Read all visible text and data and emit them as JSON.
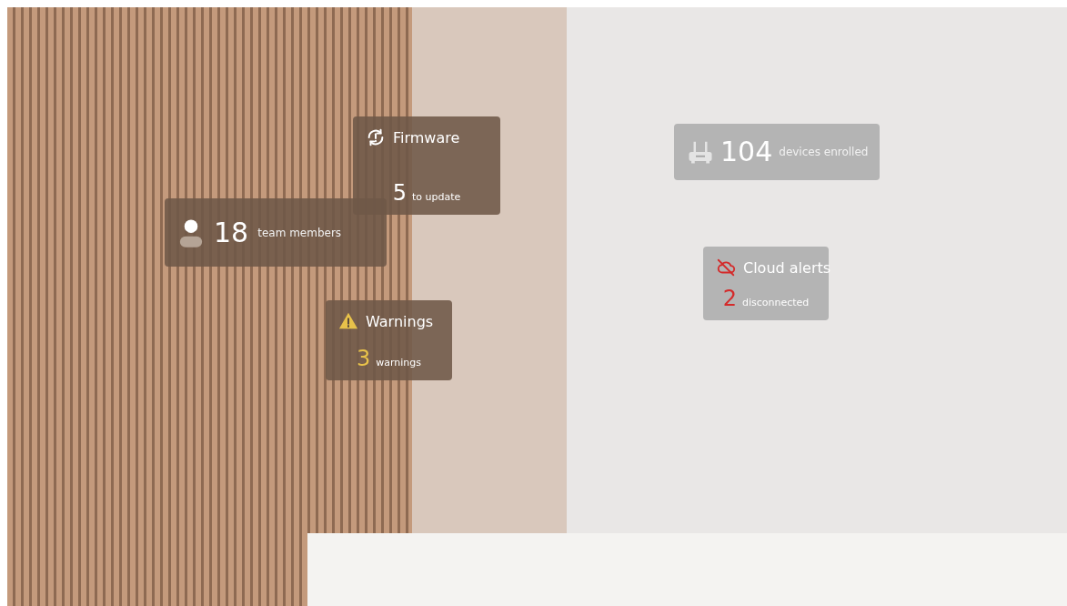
{
  "cards": [
    {
      "kind": "titled",
      "title": "Firmware",
      "count": "5",
      "label": "to update",
      "color": "#ffffff"
    },
    {
      "kind": "stat",
      "count": "18",
      "label": "team members",
      "color": "#ffffff"
    },
    {
      "kind": "titled",
      "title": "Warnings",
      "count": "3",
      "label": "warnings",
      "color": "#e8c24a"
    },
    {
      "kind": "stat",
      "count": "104",
      "label": "devices enrolled",
      "color": "#ffffff"
    },
    {
      "kind": "titled",
      "title": "Cloud alerts",
      "count": "2",
      "label": "disconnected",
      "color": "#d42a2a"
    }
  ]
}
